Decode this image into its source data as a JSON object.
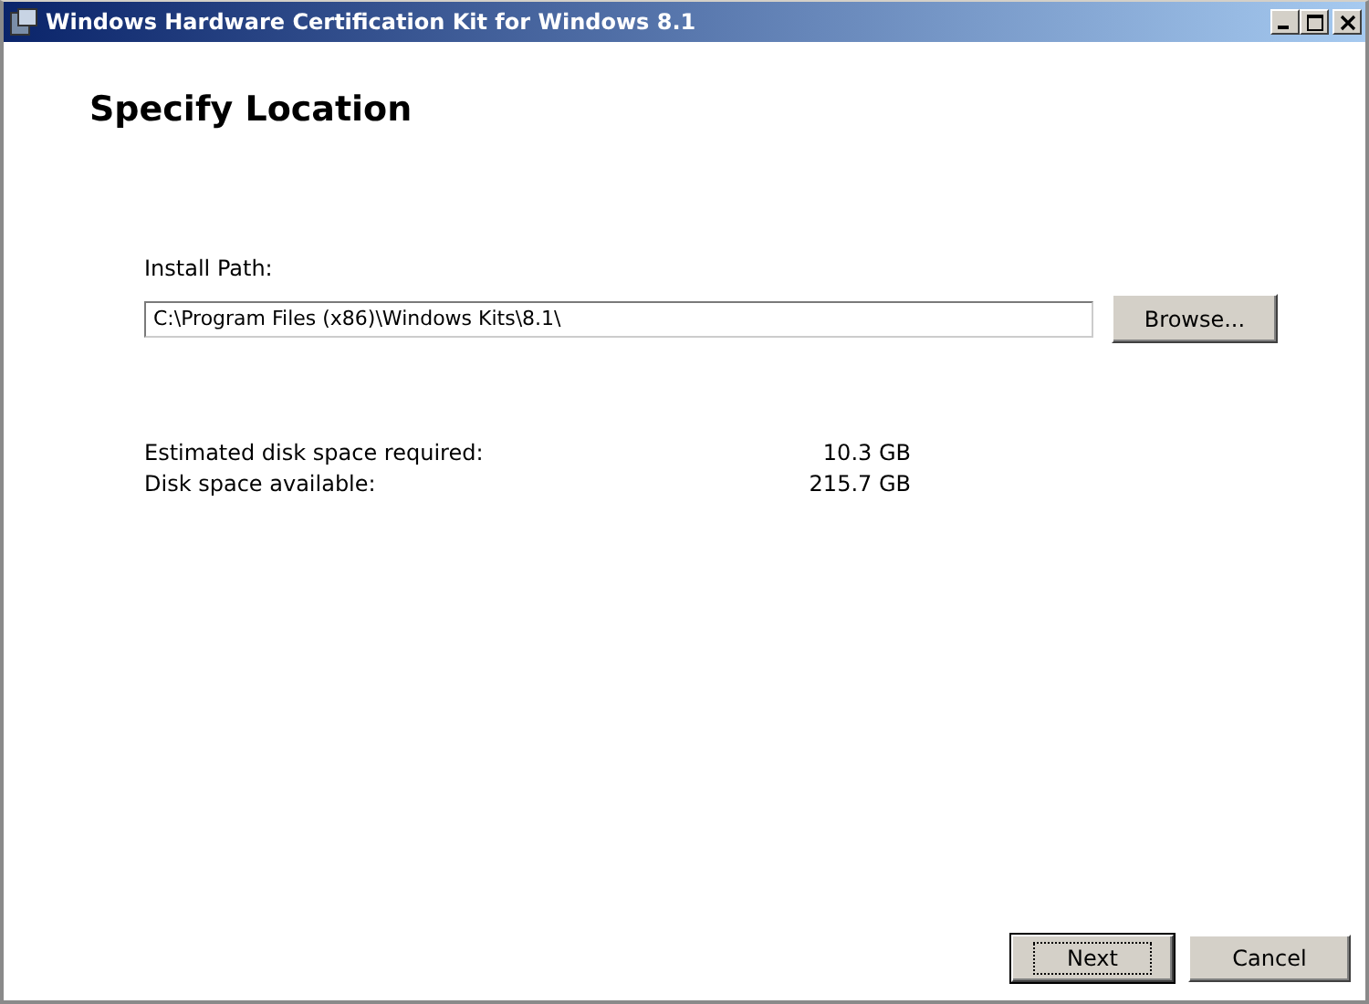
{
  "window": {
    "title": "Windows Hardware Certification Kit for Windows 8.1"
  },
  "heading": "Specify Location",
  "install_path": {
    "label": "Install Path:",
    "value": "C:\\Program Files (x86)\\Windows Kits\\8.1\\",
    "browse": "Browse..."
  },
  "disk_space": [
    {
      "label": "Estimated disk space required:",
      "value": "10.3 GB"
    },
    {
      "label": "Disk space available:",
      "value": "215.7 GB"
    }
  ],
  "buttons": [
    {
      "label": "Next",
      "default": true
    },
    {
      "label": "Cancel",
      "default": false
    }
  ]
}
